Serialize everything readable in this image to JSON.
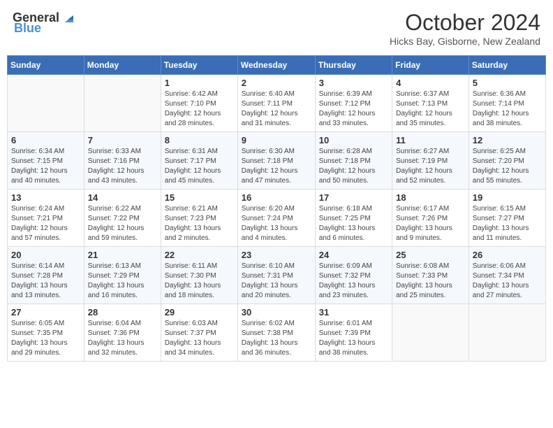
{
  "header": {
    "logo_general": "General",
    "logo_blue": "Blue",
    "title": "October 2024",
    "subtitle": "Hicks Bay, Gisborne, New Zealand"
  },
  "days_of_week": [
    "Sunday",
    "Monday",
    "Tuesday",
    "Wednesday",
    "Thursday",
    "Friday",
    "Saturday"
  ],
  "weeks": [
    [
      {
        "day": "",
        "sunrise": "",
        "sunset": "",
        "daylight": ""
      },
      {
        "day": "",
        "sunrise": "",
        "sunset": "",
        "daylight": ""
      },
      {
        "day": "1",
        "sunrise": "Sunrise: 6:42 AM",
        "sunset": "Sunset: 7:10 PM",
        "daylight": "Daylight: 12 hours and 28 minutes."
      },
      {
        "day": "2",
        "sunrise": "Sunrise: 6:40 AM",
        "sunset": "Sunset: 7:11 PM",
        "daylight": "Daylight: 12 hours and 31 minutes."
      },
      {
        "day": "3",
        "sunrise": "Sunrise: 6:39 AM",
        "sunset": "Sunset: 7:12 PM",
        "daylight": "Daylight: 12 hours and 33 minutes."
      },
      {
        "day": "4",
        "sunrise": "Sunrise: 6:37 AM",
        "sunset": "Sunset: 7:13 PM",
        "daylight": "Daylight: 12 hours and 35 minutes."
      },
      {
        "day": "5",
        "sunrise": "Sunrise: 6:36 AM",
        "sunset": "Sunset: 7:14 PM",
        "daylight": "Daylight: 12 hours and 38 minutes."
      }
    ],
    [
      {
        "day": "6",
        "sunrise": "Sunrise: 6:34 AM",
        "sunset": "Sunset: 7:15 PM",
        "daylight": "Daylight: 12 hours and 40 minutes."
      },
      {
        "day": "7",
        "sunrise": "Sunrise: 6:33 AM",
        "sunset": "Sunset: 7:16 PM",
        "daylight": "Daylight: 12 hours and 43 minutes."
      },
      {
        "day": "8",
        "sunrise": "Sunrise: 6:31 AM",
        "sunset": "Sunset: 7:17 PM",
        "daylight": "Daylight: 12 hours and 45 minutes."
      },
      {
        "day": "9",
        "sunrise": "Sunrise: 6:30 AM",
        "sunset": "Sunset: 7:18 PM",
        "daylight": "Daylight: 12 hours and 47 minutes."
      },
      {
        "day": "10",
        "sunrise": "Sunrise: 6:28 AM",
        "sunset": "Sunset: 7:18 PM",
        "daylight": "Daylight: 12 hours and 50 minutes."
      },
      {
        "day": "11",
        "sunrise": "Sunrise: 6:27 AM",
        "sunset": "Sunset: 7:19 PM",
        "daylight": "Daylight: 12 hours and 52 minutes."
      },
      {
        "day": "12",
        "sunrise": "Sunrise: 6:25 AM",
        "sunset": "Sunset: 7:20 PM",
        "daylight": "Daylight: 12 hours and 55 minutes."
      }
    ],
    [
      {
        "day": "13",
        "sunrise": "Sunrise: 6:24 AM",
        "sunset": "Sunset: 7:21 PM",
        "daylight": "Daylight: 12 hours and 57 minutes."
      },
      {
        "day": "14",
        "sunrise": "Sunrise: 6:22 AM",
        "sunset": "Sunset: 7:22 PM",
        "daylight": "Daylight: 12 hours and 59 minutes."
      },
      {
        "day": "15",
        "sunrise": "Sunrise: 6:21 AM",
        "sunset": "Sunset: 7:23 PM",
        "daylight": "Daylight: 13 hours and 2 minutes."
      },
      {
        "day": "16",
        "sunrise": "Sunrise: 6:20 AM",
        "sunset": "Sunset: 7:24 PM",
        "daylight": "Daylight: 13 hours and 4 minutes."
      },
      {
        "day": "17",
        "sunrise": "Sunrise: 6:18 AM",
        "sunset": "Sunset: 7:25 PM",
        "daylight": "Daylight: 13 hours and 6 minutes."
      },
      {
        "day": "18",
        "sunrise": "Sunrise: 6:17 AM",
        "sunset": "Sunset: 7:26 PM",
        "daylight": "Daylight: 13 hours and 9 minutes."
      },
      {
        "day": "19",
        "sunrise": "Sunrise: 6:15 AM",
        "sunset": "Sunset: 7:27 PM",
        "daylight": "Daylight: 13 hours and 11 minutes."
      }
    ],
    [
      {
        "day": "20",
        "sunrise": "Sunrise: 6:14 AM",
        "sunset": "Sunset: 7:28 PM",
        "daylight": "Daylight: 13 hours and 13 minutes."
      },
      {
        "day": "21",
        "sunrise": "Sunrise: 6:13 AM",
        "sunset": "Sunset: 7:29 PM",
        "daylight": "Daylight: 13 hours and 16 minutes."
      },
      {
        "day": "22",
        "sunrise": "Sunrise: 6:11 AM",
        "sunset": "Sunset: 7:30 PM",
        "daylight": "Daylight: 13 hours and 18 minutes."
      },
      {
        "day": "23",
        "sunrise": "Sunrise: 6:10 AM",
        "sunset": "Sunset: 7:31 PM",
        "daylight": "Daylight: 13 hours and 20 minutes."
      },
      {
        "day": "24",
        "sunrise": "Sunrise: 6:09 AM",
        "sunset": "Sunset: 7:32 PM",
        "daylight": "Daylight: 13 hours and 23 minutes."
      },
      {
        "day": "25",
        "sunrise": "Sunrise: 6:08 AM",
        "sunset": "Sunset: 7:33 PM",
        "daylight": "Daylight: 13 hours and 25 minutes."
      },
      {
        "day": "26",
        "sunrise": "Sunrise: 6:06 AM",
        "sunset": "Sunset: 7:34 PM",
        "daylight": "Daylight: 13 hours and 27 minutes."
      }
    ],
    [
      {
        "day": "27",
        "sunrise": "Sunrise: 6:05 AM",
        "sunset": "Sunset: 7:35 PM",
        "daylight": "Daylight: 13 hours and 29 minutes."
      },
      {
        "day": "28",
        "sunrise": "Sunrise: 6:04 AM",
        "sunset": "Sunset: 7:36 PM",
        "daylight": "Daylight: 13 hours and 32 minutes."
      },
      {
        "day": "29",
        "sunrise": "Sunrise: 6:03 AM",
        "sunset": "Sunset: 7:37 PM",
        "daylight": "Daylight: 13 hours and 34 minutes."
      },
      {
        "day": "30",
        "sunrise": "Sunrise: 6:02 AM",
        "sunset": "Sunset: 7:38 PM",
        "daylight": "Daylight: 13 hours and 36 minutes."
      },
      {
        "day": "31",
        "sunrise": "Sunrise: 6:01 AM",
        "sunset": "Sunset: 7:39 PM",
        "daylight": "Daylight: 13 hours and 38 minutes."
      },
      {
        "day": "",
        "sunrise": "",
        "sunset": "",
        "daylight": ""
      },
      {
        "day": "",
        "sunrise": "",
        "sunset": "",
        "daylight": ""
      }
    ]
  ]
}
